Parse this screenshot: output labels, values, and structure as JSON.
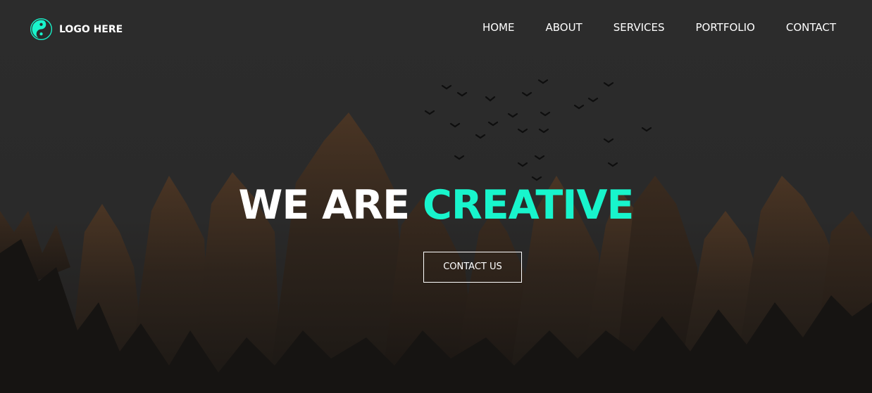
{
  "brand": {
    "logo_text": "LOGO HERE",
    "icon": "yin-yang-icon",
    "accent_color": "#18f5cc"
  },
  "nav": {
    "items": [
      {
        "label": "HOME"
      },
      {
        "label": "ABOUT"
      },
      {
        "label": "SERVICES"
      },
      {
        "label": "PORTFOLIO"
      },
      {
        "label": "CONTACT"
      }
    ]
  },
  "hero": {
    "headline_part1": "WE ARE",
    "headline_part2": "CREATIVE",
    "cta_label": "CONTACT US",
    "background": "dark-forest-with-birds"
  }
}
